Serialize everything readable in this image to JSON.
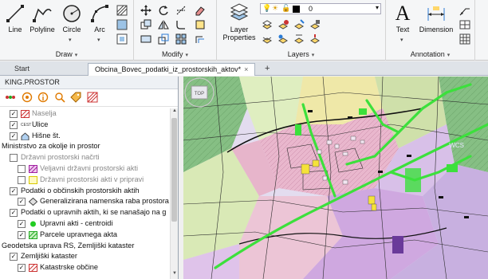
{
  "ribbon": {
    "draw": {
      "title": "Draw",
      "tools": {
        "line": "Line",
        "polyline": "Polyline",
        "circle": "Circle",
        "arc": "Arc"
      }
    },
    "modify": {
      "title": "Modify"
    },
    "layers": {
      "title": "Layers",
      "layer_properties_line1": "Layer",
      "layer_properties_line2": "Properties",
      "current_layer": "0"
    },
    "annotation": {
      "title": "Annotation",
      "text": "Text",
      "dimension": "Dimension"
    }
  },
  "tabs": [
    {
      "label": "Start"
    },
    {
      "label": "Obcina_Bovec_podatki_iz_prostorskih_aktov*"
    }
  ],
  "left_panel": {
    "title": "KING.PROSTOR",
    "tree": [
      {
        "label": "Naselja",
        "checked": true,
        "grey": true
      },
      {
        "label": "Ulice",
        "checked": true,
        "sym": "CEST"
      },
      {
        "label": "Hišne št.",
        "checked": true
      },
      {
        "label": "Ministrstvo za okolje in prostor",
        "group": true
      },
      {
        "label": "Državni prostorski načrti",
        "checked": false,
        "grey": true
      },
      {
        "label": "Veljavni državni prostorski akti",
        "checked": false,
        "grey": true
      },
      {
        "label": "Državni prostorski akti v pripravi",
        "checked": false,
        "grey": true
      },
      {
        "label": "Podatki o občinskih prostorskih aktih",
        "checked": true
      },
      {
        "label": "Generalizirana namenska raba prostora",
        "checked": true
      },
      {
        "label": "Podatki o upravnih aktih, ki se nanašajo na g",
        "checked": true
      },
      {
        "label": "Upravni akti - centroidi",
        "checked": true
      },
      {
        "label": "Parcele upravnega akta",
        "checked": true
      },
      {
        "label": "Geodetska uprava RS, Zemljiški kataster",
        "group": true
      },
      {
        "label": "Zemljiški kataster",
        "checked": true
      },
      {
        "label": "Katastrske občine",
        "checked": true
      }
    ]
  },
  "map": {
    "viewcube_label": "TOP",
    "wcs_label": "WCS",
    "colors": {
      "forest": "#7fb87e",
      "residential": "#e8b0c8",
      "agriculture": "#d8eab0",
      "purple": "#c9a0e0",
      "roads": "#3fe03f",
      "lines": "#222222"
    }
  }
}
